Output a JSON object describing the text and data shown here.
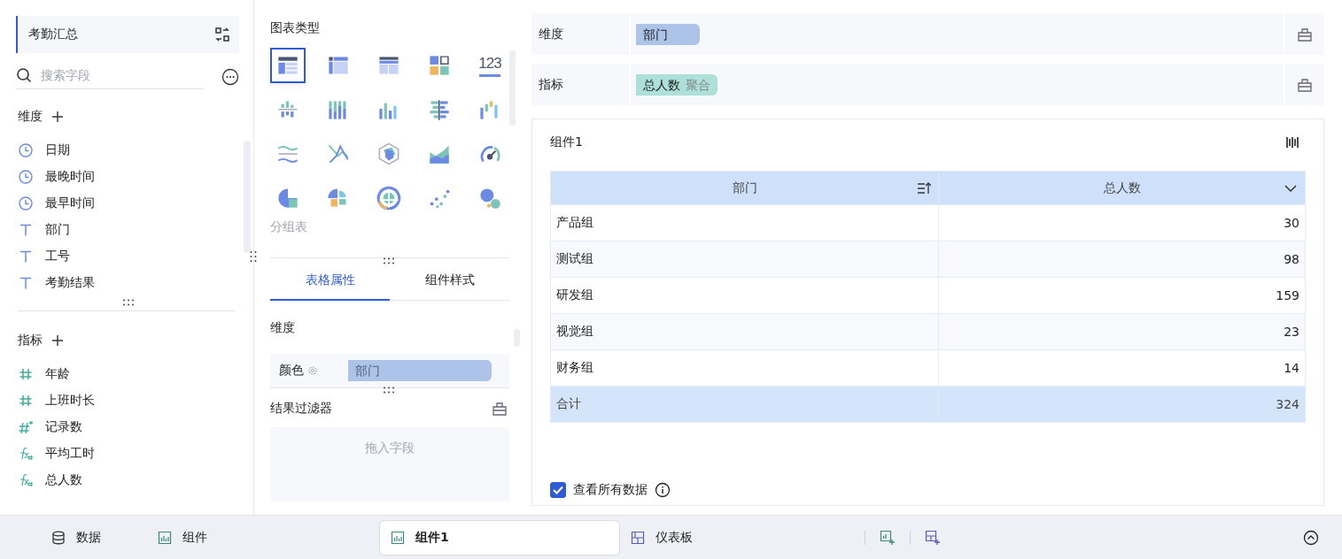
{
  "dataset": {
    "title": "考勤汇总"
  },
  "search": {
    "placeholder": "搜索字段"
  },
  "field_groups": [
    {
      "title": "维度",
      "fields": [
        {
          "name": "日期",
          "kind": "date"
        },
        {
          "name": "最晚时间",
          "kind": "date"
        },
        {
          "name": "最早时间",
          "kind": "date"
        },
        {
          "name": "部门",
          "kind": "text"
        },
        {
          "name": "工号",
          "kind": "text"
        },
        {
          "name": "考勤结果",
          "kind": "text"
        }
      ]
    },
    {
      "title": "指标",
      "fields": [
        {
          "name": "年龄",
          "kind": "number"
        },
        {
          "name": "上班时长",
          "kind": "number"
        },
        {
          "name": "记录数",
          "kind": "count"
        },
        {
          "name": "平均工时",
          "kind": "formula"
        },
        {
          "name": "总人数",
          "kind": "formula"
        }
      ]
    }
  ],
  "chart_panel": {
    "title": "图表类型",
    "hint": "分组表",
    "types": [
      {
        "kind": "table",
        "selected": true
      },
      {
        "kind": "pivot",
        "selected": false
      },
      {
        "kind": "detail",
        "selected": false
      },
      {
        "kind": "kpi-grid",
        "selected": false
      },
      {
        "kind": "number",
        "glyph": "123",
        "selected": false
      },
      {
        "kind": "dot-bar",
        "selected": false
      },
      {
        "kind": "stacked-bar",
        "selected": false
      },
      {
        "kind": "bar",
        "selected": false
      },
      {
        "kind": "diverging-bar",
        "selected": false
      },
      {
        "kind": "waterfall",
        "selected": false
      },
      {
        "kind": "wave-line",
        "selected": false
      },
      {
        "kind": "line",
        "selected": false
      },
      {
        "kind": "radar",
        "selected": false
      },
      {
        "kind": "area",
        "selected": false
      },
      {
        "kind": "gauge",
        "selected": false
      },
      {
        "kind": "pie",
        "selected": false
      },
      {
        "kind": "rose",
        "selected": false
      },
      {
        "kind": "sunburst",
        "selected": false
      },
      {
        "kind": "scatter",
        "selected": false
      },
      {
        "kind": "bubble",
        "selected": false
      }
    ]
  },
  "property_tabs": [
    {
      "label": "表格属性",
      "selected": true
    },
    {
      "label": "组件样式",
      "selected": false
    }
  ],
  "properties": {
    "section": "维度",
    "color_label": "颜色",
    "color_field": "部门",
    "filter_title": "结果过滤器",
    "filter_placeholder": "拖入字段"
  },
  "shelves": [
    {
      "label": "维度",
      "pills": [
        {
          "name": "部门",
          "kind": "dimension"
        }
      ]
    },
    {
      "label": "指标",
      "pills": [
        {
          "name": "总人数",
          "suffix": "聚合",
          "kind": "measure"
        }
      ]
    }
  ],
  "widget": {
    "title": "组件1",
    "table": {
      "columns": [
        {
          "label": "部门",
          "kind": "sort"
        },
        {
          "label": "总人数",
          "kind": "dropdown"
        }
      ],
      "rows": [
        [
          "产品组",
          "30"
        ],
        [
          "测试组",
          "98"
        ],
        [
          "研发组",
          "159"
        ],
        [
          "视觉组",
          "23"
        ],
        [
          "财务组",
          "14"
        ]
      ],
      "total": [
        "合计",
        "324"
      ]
    },
    "show_all": {
      "label": "查看所有数据",
      "checked": true
    }
  },
  "bottom_tabs": [
    {
      "label": "数据",
      "kind": "data",
      "selected": false
    },
    {
      "label": "组件",
      "kind": "widget",
      "selected": false
    },
    {
      "label": "组件1",
      "kind": "widget",
      "selected": true
    },
    {
      "label": "仪表板",
      "kind": "dashboard",
      "selected": false
    }
  ]
}
